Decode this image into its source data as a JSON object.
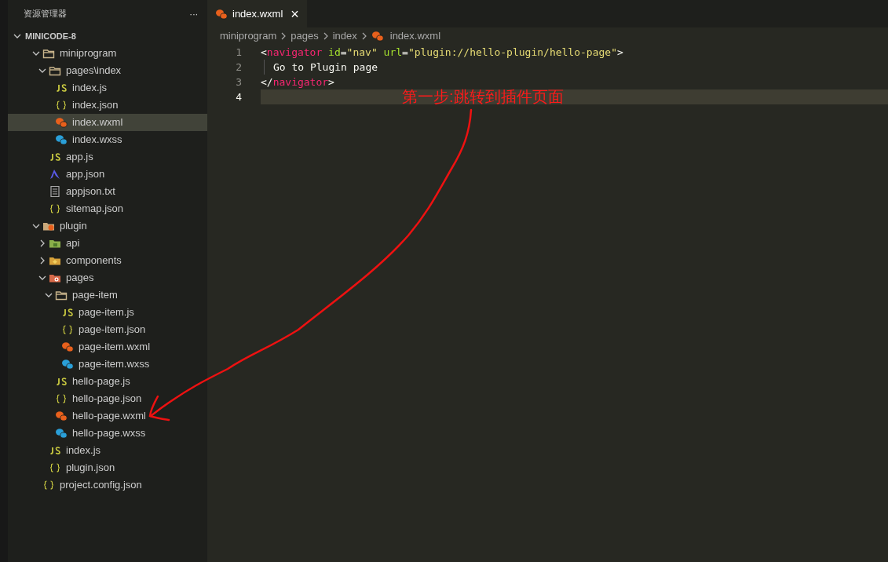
{
  "sidebar": {
    "title": "资源管理器",
    "more": "···",
    "root": {
      "label": "MINICODE-8",
      "expanded": true
    },
    "tree": [
      {
        "label": "miniprogram",
        "kind": "folder",
        "expanded": true,
        "selected": false,
        "children": [
          {
            "label": "pages\\index",
            "kind": "folder",
            "expanded": true,
            "selected": false,
            "children": [
              {
                "label": "index.js",
                "kind": "js",
                "selected": false
              },
              {
                "label": "index.json",
                "kind": "json",
                "selected": false
              },
              {
                "label": "index.wxml",
                "kind": "wxml",
                "selected": true
              },
              {
                "label": "index.wxss",
                "kind": "wxss",
                "selected": false
              }
            ]
          },
          {
            "label": "app.js",
            "kind": "js",
            "selected": false
          },
          {
            "label": "app.json",
            "kind": "appjson",
            "selected": false
          },
          {
            "label": "appjson.txt",
            "kind": "txt",
            "selected": false
          },
          {
            "label": "sitemap.json",
            "kind": "json",
            "selected": false
          }
        ]
      },
      {
        "label": "plugin",
        "kind": "plugin-folder",
        "expanded": true,
        "selected": false,
        "children": [
          {
            "label": "api",
            "kind": "api-folder",
            "expanded": false,
            "selected": false
          },
          {
            "label": "components",
            "kind": "components-folder",
            "expanded": false,
            "selected": false
          },
          {
            "label": "pages",
            "kind": "pages-folder",
            "expanded": true,
            "selected": false,
            "children": [
              {
                "label": "page-item",
                "kind": "folder",
                "expanded": true,
                "selected": false,
                "children": [
                  {
                    "label": "page-item.js",
                    "kind": "js",
                    "selected": false
                  },
                  {
                    "label": "page-item.json",
                    "kind": "json",
                    "selected": false
                  },
                  {
                    "label": "page-item.wxml",
                    "kind": "wxml",
                    "selected": false
                  },
                  {
                    "label": "page-item.wxss",
                    "kind": "wxss",
                    "selected": false
                  }
                ]
              },
              {
                "label": "hello-page.js",
                "kind": "js",
                "selected": false
              },
              {
                "label": "hello-page.json",
                "kind": "json",
                "selected": false
              },
              {
                "label": "hello-page.wxml",
                "kind": "wxml",
                "selected": false
              },
              {
                "label": "hello-page.wxss",
                "kind": "wxss",
                "selected": false
              }
            ]
          },
          {
            "label": "index.js",
            "kind": "js",
            "selected": false
          },
          {
            "label": "plugin.json",
            "kind": "json",
            "selected": false
          }
        ]
      },
      {
        "label": "project.config.json",
        "kind": "json",
        "selected": false
      }
    ]
  },
  "tabs": [
    {
      "label": "index.wxml",
      "kind": "wxml",
      "close": "×",
      "selected": true
    }
  ],
  "breadcrumbs": [
    {
      "label": "miniprogram"
    },
    {
      "label": "pages"
    },
    {
      "label": "index"
    },
    {
      "label": "index.wxml",
      "kind": "wxml"
    }
  ],
  "code": [
    {
      "number": "1",
      "current": false,
      "tokens": [
        {
          "kind": "punct",
          "text": "<"
        },
        {
          "kind": "tag",
          "text": "navigator"
        },
        {
          "kind": "attr",
          "text": " id"
        },
        {
          "kind": "punct",
          "text": "="
        },
        {
          "kind": "string",
          "text": "\"nav\""
        },
        {
          "kind": "attr",
          "text": " url"
        },
        {
          "kind": "punct",
          "text": "="
        },
        {
          "kind": "string",
          "text": "\"plugin://hello-plugin/hello-page\""
        },
        {
          "kind": "punct",
          "text": ">"
        }
      ]
    },
    {
      "number": "2",
      "current": false,
      "indent": true,
      "tokens": [
        {
          "kind": "text",
          "text": "Go to Plugin page"
        }
      ]
    },
    {
      "number": "3",
      "current": false,
      "tokens": [
        {
          "kind": "punct",
          "text": "</"
        },
        {
          "kind": "tag",
          "text": "navigator"
        },
        {
          "kind": "punct",
          "text": ">"
        }
      ]
    },
    {
      "number": "4",
      "current": true
    }
  ],
  "annotation": {
    "text": "第一步:跳转到插件页面"
  }
}
